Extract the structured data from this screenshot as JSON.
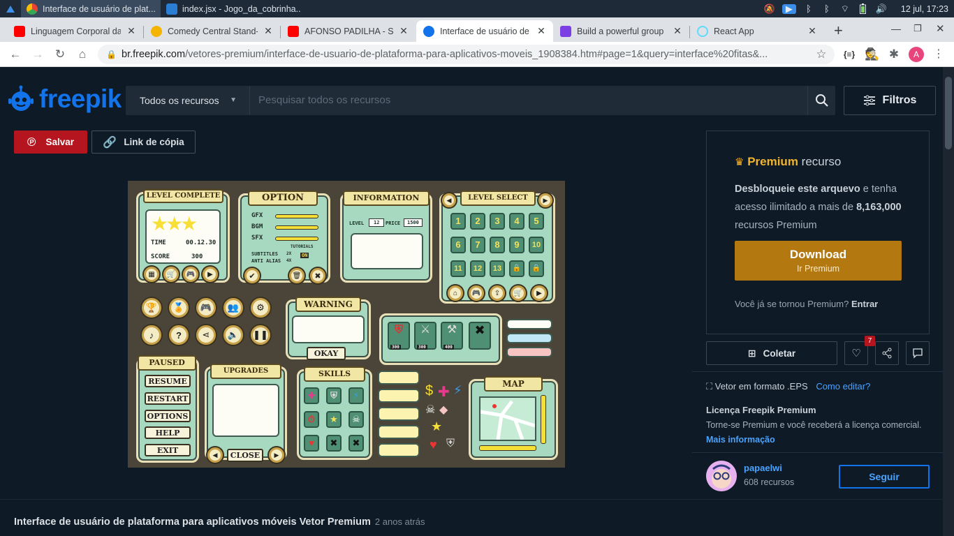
{
  "os": {
    "tasks": [
      {
        "label": "Interface de usuário de plat...",
        "active": true
      },
      {
        "label": "index.jsx - Jogo_da_cobrinha...",
        "active": false
      }
    ],
    "clock": "12 jul, 17:23"
  },
  "browser": {
    "tabs": [
      {
        "title": "Linguagem Corporal da",
        "favicon_color": "#ff0000"
      },
      {
        "title": "Comedy Central Stand-U",
        "favicon_color": "#f4b400"
      },
      {
        "title": "AFONSO PADILHA - SOU",
        "favicon_color": "#ff0000"
      },
      {
        "title": "Interface de usuário de",
        "favicon_color": "#1273eb"
      },
      {
        "title": "Build a powerful group",
        "favicon_color": "#7b3fe4"
      },
      {
        "title": "React App",
        "favicon_color": "#61dafb"
      }
    ],
    "new_tab": "+",
    "url_host": "br.freepik.com",
    "url_path": "/vetores-premium/interface-de-usuario-de-plataforma-para-aplicativos-moveis_1908384.htm#page=1&query=interface%20fitas&...",
    "profile_initial": "A"
  },
  "site": {
    "logo_text": "freepik",
    "search": {
      "category": "Todos os recursos",
      "placeholder": "Pesquisar todos os recursos"
    },
    "filters_label": "Filtros",
    "save_label": "Salvar",
    "copy_link_label": "Link de cópia"
  },
  "preview": {
    "panels": {
      "level_complete": "LEVEL COMPLETE",
      "option": "OPTION",
      "information": "INFORMATION",
      "level_select": "LEVEL SELECT",
      "warning": "WARNING",
      "paused": "PAUSED",
      "upgrades": "UPGRADES",
      "skills": "SKILLS",
      "map": "MAP"
    },
    "level_complete": {
      "time_label": "TIME",
      "time": "00.12.30",
      "score_label": "SCORE",
      "score": "300"
    },
    "option": {
      "gfx": "GFX",
      "bgm": "BGM",
      "sfx": "SFX",
      "subtitles": "SUBTITLES",
      "anti_alias": "ANTI ALIAS",
      "tutorials": "TUTORIALS",
      "on": "ON",
      "x2": "2X",
      "x4": "4X"
    },
    "information": {
      "level_label": "LEVEL",
      "level": "12",
      "price_label": "PRICE",
      "price": "1500"
    },
    "levels": [
      "1",
      "2",
      "3",
      "4",
      "5",
      "6",
      "7",
      "8",
      "9",
      "10",
      "11",
      "12",
      "13"
    ],
    "warning_button": "OKAY",
    "weapons_prices": [
      "300",
      "300",
      "400"
    ],
    "paused_buttons": [
      "RESUME",
      "RESTART",
      "OPTIONS",
      "HELP",
      "EXIT"
    ],
    "close_button": "CLOSE"
  },
  "premium": {
    "title_bold": "Premium",
    "title_rest": "recurso",
    "text_bold1": "Desbloqueie este arquevo",
    "text_1": "e tenha acesso ilimitado a mais de",
    "text_bold2": "8,163,000",
    "text_2": "recursos Premium",
    "download": "Download",
    "download_sub": "Ir Premium",
    "already": "Você já se tornou Premium?",
    "enter": "Entrar"
  },
  "actions": {
    "collect": "Coletar",
    "likes": "7"
  },
  "details": {
    "format": "Vetor em formato .EPS",
    "how_edit": "Como editar?",
    "license_title": "Licença Freepik Premium",
    "license_text": "Torne-se Premium e você receberá a licença comercial.",
    "more_info": "Mais informação"
  },
  "author": {
    "name": "papaelwi",
    "resources": "608 recursos",
    "follow": "Seguir"
  },
  "page_title": "Interface de usuário de plataforma para aplicativos móveis Vetor Premium",
  "page_age": "2 anos atrás",
  "colors": {
    "brand": "#1273eb",
    "premium": "#f2b42c",
    "download": "#b3780f",
    "pinterest": "#b5151e"
  }
}
